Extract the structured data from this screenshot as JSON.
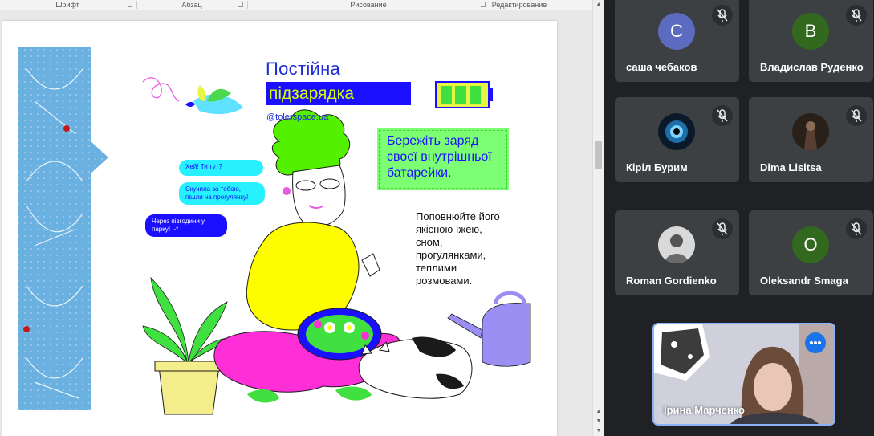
{
  "ribbon": {
    "groups": [
      {
        "label": "Шрифт"
      },
      {
        "label": "Абзац"
      },
      {
        "label": "Рисование"
      },
      {
        "label": "Редактирование"
      }
    ]
  },
  "poster": {
    "title_line1": "Постійна",
    "title_line2": "підзарядка",
    "handle": "@tolerspace.ua",
    "note": "Бережіть заряд своєї внутрішньої батарейки.",
    "paragraph": "Поповнюйте його якісною їжею, сном, прогулянками, теплими розмовами.",
    "bubbles": [
      "Хей! Ти тут?",
      "Скучила за тобою, пішли на прогулянку!",
      "Через півгодини у парку! :-*"
    ]
  },
  "meet": {
    "participants": [
      {
        "name": "саша чебаков",
        "initial": "С",
        "color": "#5c6bc0",
        "muted": true
      },
      {
        "name": "Владислав Руденко",
        "initial": "В",
        "color": "#33691e",
        "muted": true
      },
      {
        "name": "Кірiл Бурим",
        "photo": "eye",
        "muted": true
      },
      {
        "name": "Dima Lisitsa",
        "photo": "dark",
        "muted": true
      },
      {
        "name": "Roman Gordienko",
        "photo": "person",
        "muted": true
      },
      {
        "name": "Oleksandr Smaga",
        "initial": "O",
        "color": "#33691e",
        "muted": true
      }
    ],
    "self": {
      "name": "Ірина Марченко"
    }
  }
}
